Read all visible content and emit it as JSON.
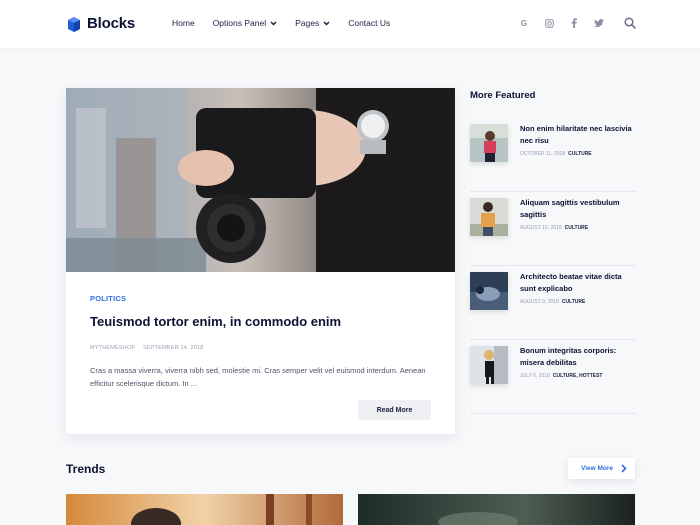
{
  "header": {
    "logo_text": "Blocks",
    "nav": [
      {
        "label": "Home",
        "dropdown": false
      },
      {
        "label": "Options Panel",
        "dropdown": true
      },
      {
        "label": "Pages",
        "dropdown": true
      },
      {
        "label": "Contact Us",
        "dropdown": false
      }
    ],
    "socials": [
      "google-icon",
      "instagram-icon",
      "facebook-icon",
      "twitter-icon"
    ],
    "search_icon": "search-icon",
    "accent": "#2f6fde"
  },
  "main_post": {
    "category": "POLITICS",
    "title": "Teuismod tortor enim, in commodo enim",
    "author": "MYTHEMESHOP",
    "date": "SEPTEMBER 14, 2018",
    "excerpt": "Cras a massa viverra, viverra nibh sed, molestie mi. Cras semper velit vel euismod interdum. Aenean efficitur scelerisque dictum. In ...",
    "read_more": "Read More"
  },
  "sidebar": {
    "title": "More Featured",
    "items": [
      {
        "title": "Non enim hilaritate nec lascivia nec risu",
        "date": "OCTOBER 11, 2018",
        "category": "CULTURE"
      },
      {
        "title": "Aliquam sagittis vestibulum sagittis",
        "date": "AUGUST 10, 2018",
        "category": "CULTURE"
      },
      {
        "title": "Architecto beatae vitae dicta sunt explicabo",
        "date": "AUGUST 9, 2018",
        "category": "CULTURE"
      },
      {
        "title": "Bonum integritas corporis: misera debilitas",
        "date": "JULY 6, 2018",
        "category": "CULTURE, HOTTEST"
      }
    ]
  },
  "trends": {
    "title": "Trends",
    "view_more": "View More"
  }
}
